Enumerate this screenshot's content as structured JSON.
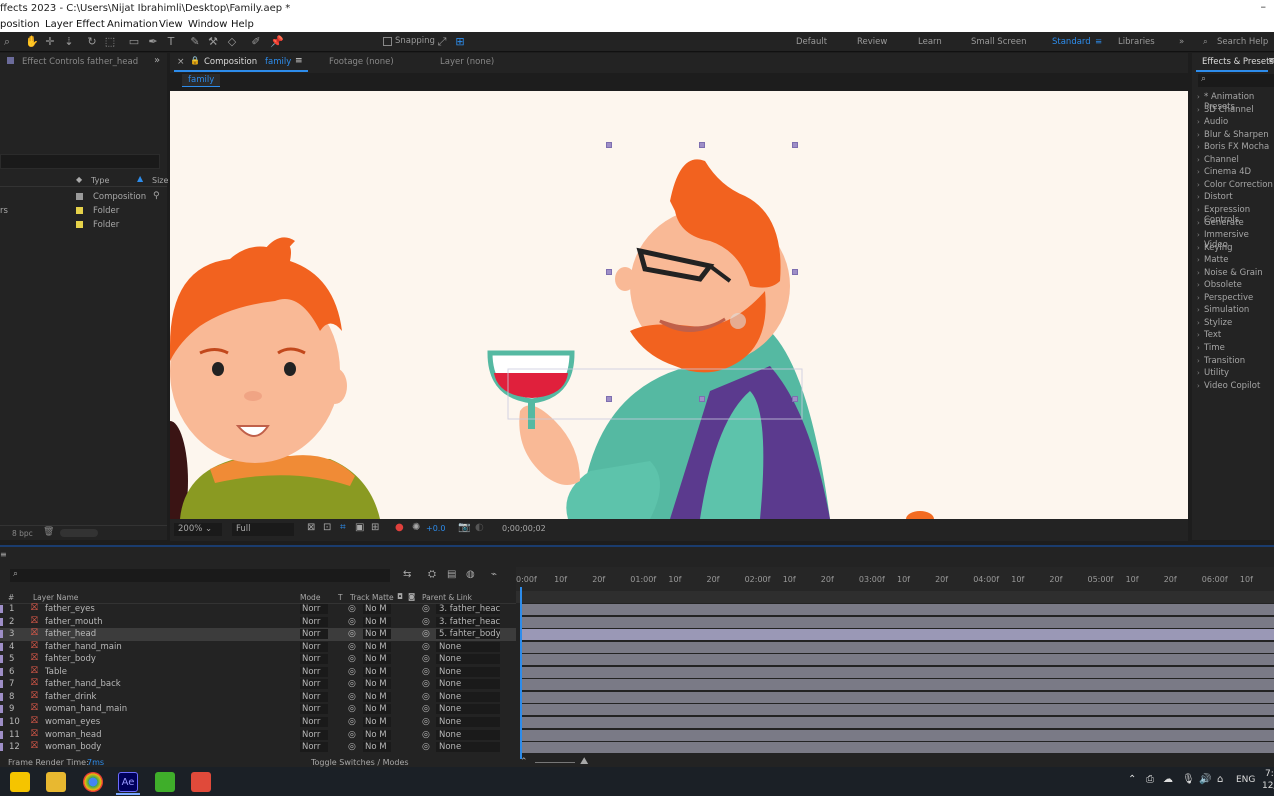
{
  "window": {
    "title": "ffects 2023 - C:\\Users\\Nijat Ibrahimli\\Desktop\\Family.aep *"
  },
  "menu": [
    "position",
    "Layer",
    "Effect",
    "Animation",
    "View",
    "Window",
    "Help"
  ],
  "toolbar": {
    "snapping_label": "Snapping",
    "workspaces": [
      "Default",
      "Review",
      "Learn",
      "Small Screen",
      "Standard",
      "Libraries"
    ],
    "active_workspace": "Standard",
    "search_help": "Search Help"
  },
  "left_panel": {
    "effect_controls_tab": "Effect Controls father_head",
    "columns": {
      "type": "Type",
      "size": "Size"
    },
    "items": [
      {
        "name": "",
        "type": "Composition",
        "color": "#9a9a9a"
      },
      {
        "name": "rs",
        "type": "Folder",
        "color": "#e6d24a"
      },
      {
        "name": "",
        "type": "Folder",
        "color": "#e6d24a"
      }
    ],
    "bpc": "8 bpc"
  },
  "comp_panel": {
    "comp_tab": "Composition",
    "comp_name": "family",
    "footage_tab": "Footage (none)",
    "layer_tab": "Layer (none)",
    "breadcrumb": "family",
    "zoom": "200%",
    "resolution": "Full",
    "exposure": "+0.0",
    "timecode": "0;00;00;02"
  },
  "effects_presets": {
    "title": "Effects & Presets",
    "categories": [
      "* Animation Presets",
      "3D Channel",
      "Audio",
      "Blur & Sharpen",
      "Boris FX Mocha",
      "Channel",
      "Cinema 4D",
      "Color Correction",
      "Distort",
      "Expression Controls",
      "Generate",
      "Immersive Video",
      "Keying",
      "Matte",
      "Noise & Grain",
      "Obsolete",
      "Perspective",
      "Simulation",
      "Stylize",
      "Text",
      "Time",
      "Transition",
      "Utility",
      "Video Copilot"
    ]
  },
  "timeline": {
    "headers": {
      "num": "#",
      "layer_name": "Layer Name",
      "mode": "Mode",
      "t": "T",
      "track_matte": "Track Matte",
      "parent": "Parent & Link"
    },
    "ruler": [
      "0:00f",
      "10f",
      "20f",
      "01:00f",
      "10f",
      "20f",
      "02:00f",
      "10f",
      "20f",
      "03:00f",
      "10f",
      "20f",
      "04:00f",
      "10f",
      "20f",
      "05:00f",
      "10f",
      "20f",
      "06:00f",
      "10f"
    ],
    "layers": [
      {
        "num": "1",
        "name": "father_eyes",
        "mode": "Norr",
        "matte": "No M",
        "parent": "3. father_heac"
      },
      {
        "num": "2",
        "name": "father_mouth",
        "mode": "Norr",
        "matte": "No M",
        "parent": "3. father_heac"
      },
      {
        "num": "3",
        "name": "father_head",
        "mode": "Norr",
        "matte": "No M",
        "parent": "5. fahter_body"
      },
      {
        "num": "4",
        "name": "father_hand_main",
        "mode": "Norr",
        "matte": "No M",
        "parent": "None"
      },
      {
        "num": "5",
        "name": "fahter_body",
        "mode": "Norr",
        "matte": "No M",
        "parent": "None"
      },
      {
        "num": "6",
        "name": "Table",
        "mode": "Norr",
        "matte": "No M",
        "parent": "None"
      },
      {
        "num": "7",
        "name": "father_hand_back",
        "mode": "Norr",
        "matte": "No M",
        "parent": "None"
      },
      {
        "num": "8",
        "name": "father_drink",
        "mode": "Norr",
        "matte": "No M",
        "parent": "None"
      },
      {
        "num": "9",
        "name": "woman_hand_main",
        "mode": "Norr",
        "matte": "No M",
        "parent": "None"
      },
      {
        "num": "10",
        "name": "woman_eyes",
        "mode": "Norr",
        "matte": "No M",
        "parent": "None"
      },
      {
        "num": "11",
        "name": "woman_head",
        "mode": "Norr",
        "matte": "No M",
        "parent": "None"
      },
      {
        "num": "12",
        "name": "woman_body",
        "mode": "Norr",
        "matte": "No M",
        "parent": "None"
      }
    ],
    "selected_layer": 3,
    "render_time_label": "Frame Render Time:",
    "render_time_value": "7ms",
    "toggle_label": "Toggle Switches / Modes"
  },
  "taskbar": {
    "lang": "ENG",
    "time": "7:",
    "date": "12/"
  },
  "colors": {
    "accent_blue": "#2d8ceb",
    "selection_purple": "#9e8ec7",
    "hair_orange": "#f26b21",
    "track_lavender": "#7a7a86"
  }
}
